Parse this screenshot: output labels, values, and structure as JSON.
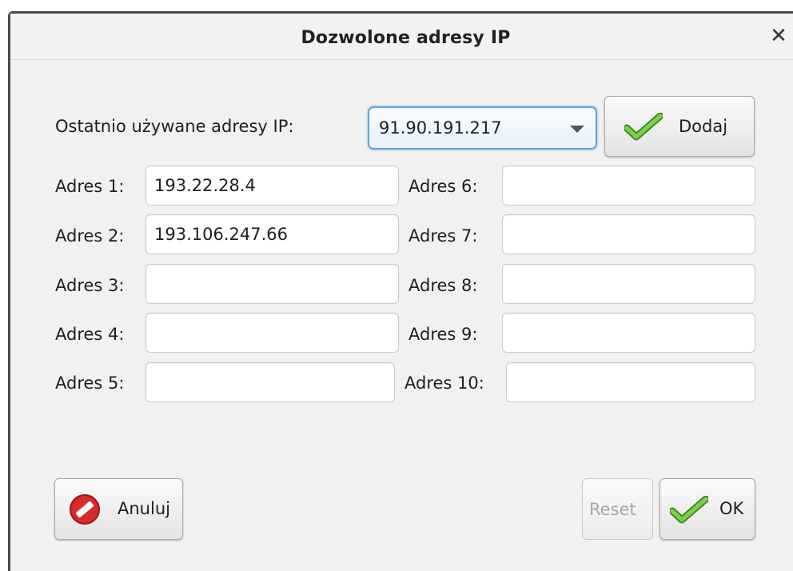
{
  "dialog": {
    "title": "Dozwolone adresy IP",
    "close_glyph": "✕"
  },
  "recent": {
    "label": "Ostatnio używane adresy IP:",
    "selected": "91.90.191.217",
    "add_label": "Dodaj"
  },
  "addresses": {
    "left": [
      {
        "label": "Adres 1:",
        "value": "193.22.28.4"
      },
      {
        "label": "Adres 2:",
        "value": "193.106.247.66"
      },
      {
        "label": "Adres 3:",
        "value": ""
      },
      {
        "label": "Adres 4:",
        "value": ""
      },
      {
        "label": "Adres 5:",
        "value": ""
      }
    ],
    "right": [
      {
        "label": "Adres 6:",
        "value": ""
      },
      {
        "label": "Adres 7:",
        "value": ""
      },
      {
        "label": "Adres 8:",
        "value": ""
      },
      {
        "label": "Adres 9:",
        "value": ""
      },
      {
        "label": "Adres 10:",
        "value": ""
      }
    ]
  },
  "footer": {
    "cancel_label": "Anuluj",
    "reset_label": "Reset",
    "ok_label": "OK"
  },
  "icons": {
    "add": "check-icon",
    "ok": "check-icon",
    "cancel": "no-entry-icon"
  },
  "colors": {
    "check_green": "#5fae3a",
    "cancel_red": "#d62b2b",
    "focus_blue": "#5ea5dc"
  }
}
